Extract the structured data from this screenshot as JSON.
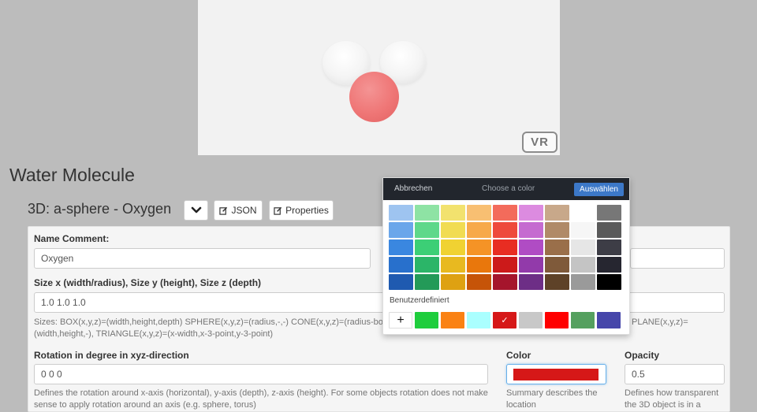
{
  "viewer": {
    "vr_label": "VR"
  },
  "page": {
    "title": "Water Molecule"
  },
  "object": {
    "title": "3D: a-sphere - Oxygen",
    "json_label": "JSON",
    "properties_label": "Properties"
  },
  "form": {
    "name_label": "Name Comment:",
    "name_value": "Oxygen",
    "size_label": "Size x (width/radius), Size y (height), Size z (depth)",
    "size_value": "1.0 1.0 1.0",
    "size_help_1": "Sizes: BOX(x,y,z)=(width,height,depth) SPHERE(x,y,z)=(radius,-,-) CONE(x,y,z)=(radius-botto",
    "size_help_1b": "PLANE(x,y,z)=",
    "size_help_2": "(width,height,-), TRIANGLE(x,y,z)=(x-width,x-3-point,y-3-point)",
    "rotation_label": "Rotation in degree in xyz-direction",
    "rotation_value": "0 0 0",
    "rotation_help_1": "Defines the rotation around x-axis (horizontal), y-axis (depth), z-axis (height). For some objects rotation does not make",
    "rotation_help_2": "sense to apply rotation around an axis (e.g. sphere, torus)",
    "color_label": "Color",
    "color_help_1": "Summary describes the",
    "color_help_2": "location",
    "opacity_label": "Opacity",
    "opacity_value": "0.5",
    "opacity_help_1": "Defines how transparent",
    "opacity_help_2": "the 3D object is in a"
  },
  "picker": {
    "cancel_label": "Abbrechen",
    "title": "Choose a color",
    "ok_label": "Auswählen",
    "custom_label": "Benutzerdefiniert",
    "add_symbol": "+",
    "check_symbol": "✓",
    "palette": [
      [
        "#9ec4f0",
        "#8ee3a4",
        "#f2e26e",
        "#f8bf72",
        "#f36b5b",
        "#dc8be0",
        "#c8a88a",
        "#ffffff",
        "#777777"
      ],
      [
        "#6aa6ea",
        "#5ed88a",
        "#f1dc52",
        "#f7a94a",
        "#ee4a3c",
        "#c56bd0",
        "#b08a68",
        "#f6f6f6",
        "#5a5a5a"
      ],
      [
        "#3a87e0",
        "#3ccf76",
        "#f0d232",
        "#f59326",
        "#e82d22",
        "#b04cc4",
        "#9a6f4a",
        "#e6e6e6",
        "#3d3d46"
      ],
      [
        "#2870cc",
        "#2bb568",
        "#e8b920",
        "#e9770c",
        "#cc1a1a",
        "#923aaa",
        "#7f5a3a",
        "#c4c4c4",
        "#262630"
      ],
      [
        "#1f5ab0",
        "#239a58",
        "#dea112",
        "#c65408",
        "#a5152c",
        "#6d2e86",
        "#5e4228",
        "#9a9a9a",
        "#000000"
      ]
    ],
    "custom": [
      "#1ecd3c",
      "#fa8214",
      "#aaffff",
      "#d61818",
      "#c8c8c8",
      "#ff0000",
      "#55a05f",
      "#4646aa"
    ]
  }
}
